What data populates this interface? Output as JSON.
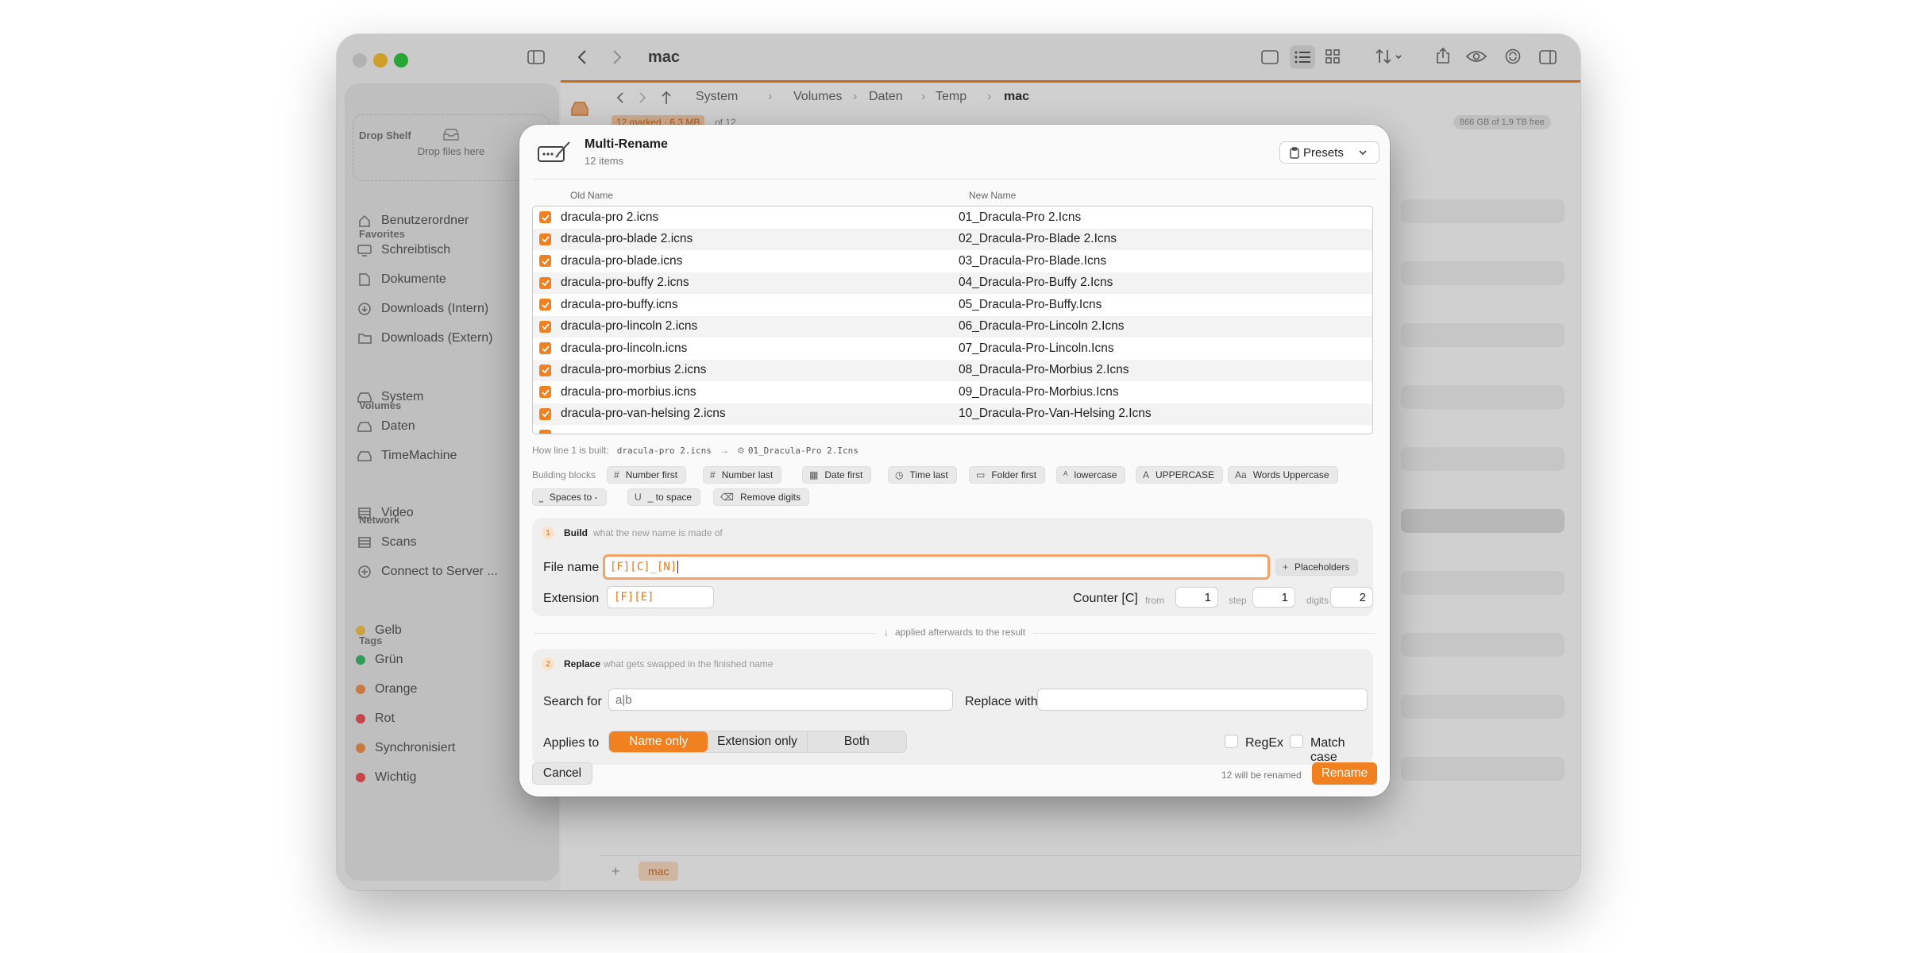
{
  "window": {
    "title": "mac",
    "toolbar_icons": [
      "sidebar-toggle-icon",
      "back-icon",
      "forward-icon",
      "single-pane-icon",
      "list-view-icon",
      "grid-view-icon",
      "sort-icon",
      "share-icon",
      "preview-icon",
      "sync-icon",
      "inspector-icon"
    ]
  },
  "sidebar": {
    "drop_shelf_title": "Drop Shelf",
    "drop_text": "Drop files here",
    "favorites_title": "Favorites",
    "favorites": [
      "Benutzerordner",
      "Schreibtisch",
      "Dokumente",
      "Downloads (Intern)",
      "Downloads (Extern)"
    ],
    "volumes_title": "Volumes",
    "volumes": [
      "System",
      "Daten",
      "TimeMachine"
    ],
    "network_title": "Network",
    "network": [
      "Video",
      "Scans",
      "Connect to Server ..."
    ],
    "tags_title": "Tags",
    "tags": [
      {
        "label": "Gelb",
        "color": "#f1c24a"
      },
      {
        "label": "Grün",
        "color": "#3fb86a"
      },
      {
        "label": "Orange",
        "color": "#f0914a"
      },
      {
        "label": "Rot",
        "color": "#e9555a"
      },
      {
        "label": "Synchronisiert",
        "color": "#f0914a"
      },
      {
        "label": "Wichtig",
        "color": "#e9555a"
      }
    ]
  },
  "browser": {
    "breadcrumb": [
      "System",
      "Volumes",
      "Daten",
      "Temp",
      "mac"
    ],
    "status_marked": "12 marked · 6,3 MB",
    "status_of": "of 12",
    "free_space": "866 GB of 1,9 TB free",
    "tab_label": "mac"
  },
  "dialog": {
    "title": "Multi-Rename",
    "subtitle": "12 items",
    "presets_label": "Presets",
    "col_old": "Old Name",
    "col_new": "New Name",
    "rows": [
      {
        "old": "dracula-pro 2.icns",
        "new": "01_Dracula-Pro 2.Icns"
      },
      {
        "old": "dracula-pro-blade 2.icns",
        "new": "02_Dracula-Pro-Blade 2.Icns"
      },
      {
        "old": "dracula-pro-blade.icns",
        "new": "03_Dracula-Pro-Blade.Icns"
      },
      {
        "old": "dracula-pro-buffy 2.icns",
        "new": "04_Dracula-Pro-Buffy 2.Icns"
      },
      {
        "old": "dracula-pro-buffy.icns",
        "new": "05_Dracula-Pro-Buffy.Icns"
      },
      {
        "old": "dracula-pro-lincoln 2.icns",
        "new": "06_Dracula-Pro-Lincoln 2.Icns"
      },
      {
        "old": "dracula-pro-lincoln.icns",
        "new": "07_Dracula-Pro-Lincoln.Icns"
      },
      {
        "old": "dracula-pro-morbius 2.icns",
        "new": "08_Dracula-Pro-Morbius 2.Icns"
      },
      {
        "old": "dracula-pro-morbius.icns",
        "new": "09_Dracula-Pro-Morbius.Icns"
      },
      {
        "old": "dracula-pro-van-helsing 2.icns",
        "new": "10_Dracula-Pro-Van-Helsing 2.Icns"
      }
    ],
    "line_hint_label": "How line 1 is built:",
    "line_hint_from": "dracula-pro 2.icns",
    "line_hint_to": "01_Dracula-Pro 2.Icns",
    "blocks_label": "Building blocks",
    "blocks": [
      {
        "glyph": "#",
        "label": "Number first"
      },
      {
        "glyph": "#",
        "label": "Number last"
      },
      {
        "glyph": "▦",
        "label": "Date first"
      },
      {
        "glyph": "◷",
        "label": "Time last"
      },
      {
        "glyph": "▭",
        "label": "Folder first"
      },
      {
        "glyph": "ᴬ",
        "label": "lowercase"
      },
      {
        "glyph": "A",
        "label": "UPPERCASE"
      },
      {
        "glyph": "Aa",
        "label": "Words Uppercase"
      },
      {
        "glyph": "⎵",
        "label": "Spaces to -"
      },
      {
        "glyph": "U",
        "label": "_ to space"
      },
      {
        "glyph": "⌫",
        "label": "Remove digits"
      }
    ],
    "build": {
      "number": "1",
      "title": "Build",
      "subtitle": "what the new name is made of",
      "file_name_label": "File name",
      "file_name_value": "[F][C]_[N]",
      "placeholders_label": "Placeholders",
      "extension_label": "Extension",
      "extension_value": "[F][E]",
      "counter_label": "Counter [C]",
      "from_label": "from",
      "from_value": "1",
      "step_label": "step",
      "step_value": "1",
      "digits_label": "digits",
      "digits_value": "2"
    },
    "divider_text": "applied afterwards to the result",
    "replace": {
      "number": "2",
      "title": "Replace",
      "subtitle": "what gets swapped in the finished name",
      "search_label": "Search for",
      "search_placeholder": "a|b",
      "replace_label": "Replace with",
      "replace_value": "",
      "applies_label": "Applies to",
      "segments": [
        "Name only",
        "Extension only",
        "Both"
      ],
      "selected_segment": "Name only",
      "regex_label": "RegEx",
      "match_case_label": "Match case"
    },
    "cancel_label": "Cancel",
    "status_text": "12 will be renamed",
    "rename_label": "Rename",
    "accent": "#f08020"
  }
}
